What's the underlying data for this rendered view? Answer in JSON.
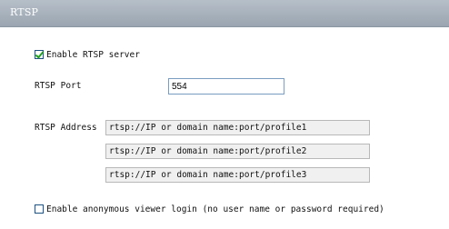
{
  "header": {
    "title": "RTSP"
  },
  "enable_server": {
    "label": "Enable RTSP server",
    "checked": true
  },
  "port": {
    "label": "RTSP Port",
    "value": "554"
  },
  "address": {
    "label": "RTSP Address",
    "values": [
      "rtsp://IP or domain name:port/profile1",
      "rtsp://IP or domain name:port/profile2",
      "rtsp://IP or domain name:port/profile3"
    ]
  },
  "anonymous": {
    "label": "Enable anonymous viewer login (no user name or password required)",
    "checked": false
  }
}
